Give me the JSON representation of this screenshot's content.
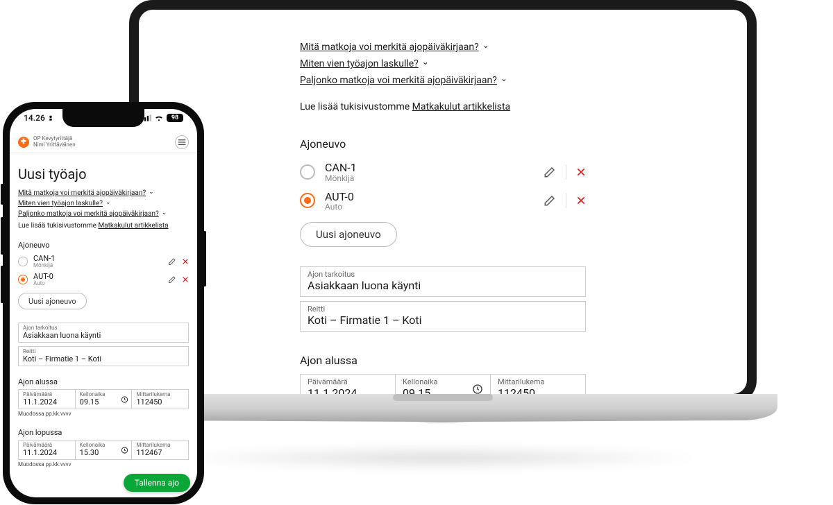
{
  "page_title": "Uusi työajo",
  "faq": {
    "q1": "Mitä matkoja voi merkitä ajopäiväkirjaan?",
    "q2": "Miten vien työajon laskulle?",
    "q3": "Paljonko matkoja voi merkitä ajopäiväkirjaan?",
    "more_prefix": "Lue lisää tukisivustomme ",
    "more_link": "Matkakulut artikkelista"
  },
  "vehicle": {
    "heading": "Ajoneuvo",
    "items": [
      {
        "plate": "CAN-1",
        "kind": "Mönkijä",
        "selected": false
      },
      {
        "plate": "AUT-0",
        "kind": "Auto",
        "selected": true
      }
    ],
    "new_button": "Uusi ajoneuvo"
  },
  "fields": {
    "purpose_label": "Ajon tarkoitus",
    "purpose_value": "Asiakkaan luona käynti",
    "route_label": "Reitti",
    "route_value": "Koti – Firmatie 1 – Koti"
  },
  "sections": {
    "start": {
      "heading": "Ajon alussa",
      "date_label": "Päivämäärä",
      "date_value": "11.1.2024",
      "time_label": "Kellonaika",
      "time_value": "09.15",
      "odo_label": "Mittarilukema",
      "odo_value": "112450",
      "helper": "Muodossa pp.kk.vvvv"
    },
    "end": {
      "heading": "Ajon lopussa",
      "date_label": "Päivämäärä",
      "date_value": "11.1.2024",
      "time_label": "Kellonaika",
      "time_value": "15.30",
      "odo_label": "Mittarilukema",
      "odo_value": "112467",
      "helper": "Muodossa pp.kk.vvvv"
    }
  },
  "buttons": {
    "save": "Tallenna ajo"
  },
  "phone": {
    "status_time": "14.26",
    "battery": "98",
    "app_line1": "OP Kevytyrittäjä",
    "app_line2": "Nimi Yrittäväinen"
  }
}
